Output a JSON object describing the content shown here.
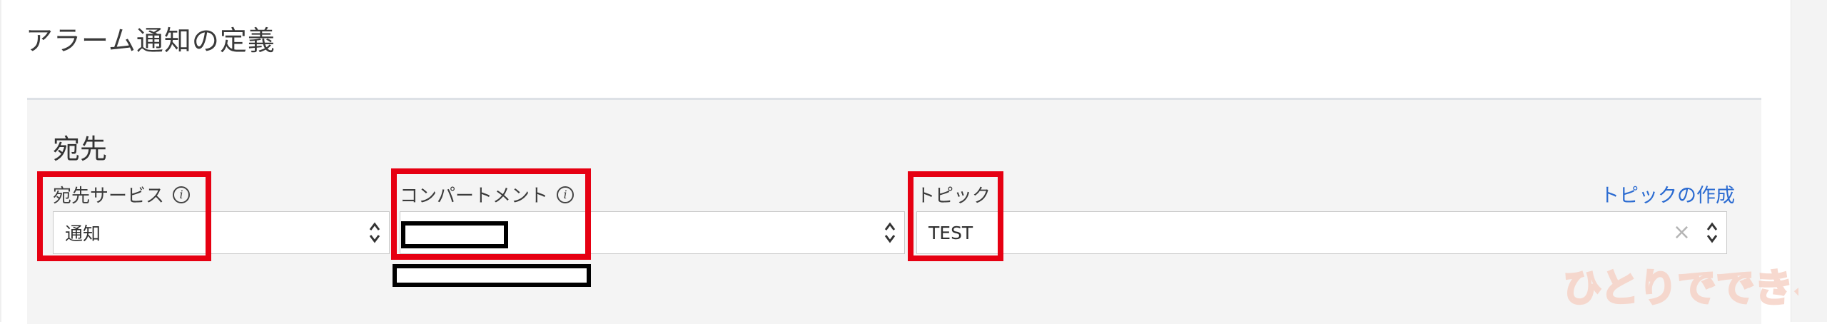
{
  "page": {
    "title": "アラーム通知の定義"
  },
  "section": {
    "title": "宛先"
  },
  "fields": {
    "service": {
      "label": "宛先サービス",
      "value": "通知"
    },
    "compartment": {
      "label": "コンパートメント",
      "value": ""
    },
    "topic": {
      "label": "トピック",
      "value": "TEST",
      "create_link": "トピックの作成"
    }
  },
  "colors": {
    "highlight": "#e60012",
    "link": "#2b6bd1",
    "panel": "#f4f4f4"
  },
  "icons": [
    "info-icon",
    "chevron-updown-icon",
    "clear-icon"
  ],
  "watermark": {
    "text": "ひとりでできるもん"
  }
}
